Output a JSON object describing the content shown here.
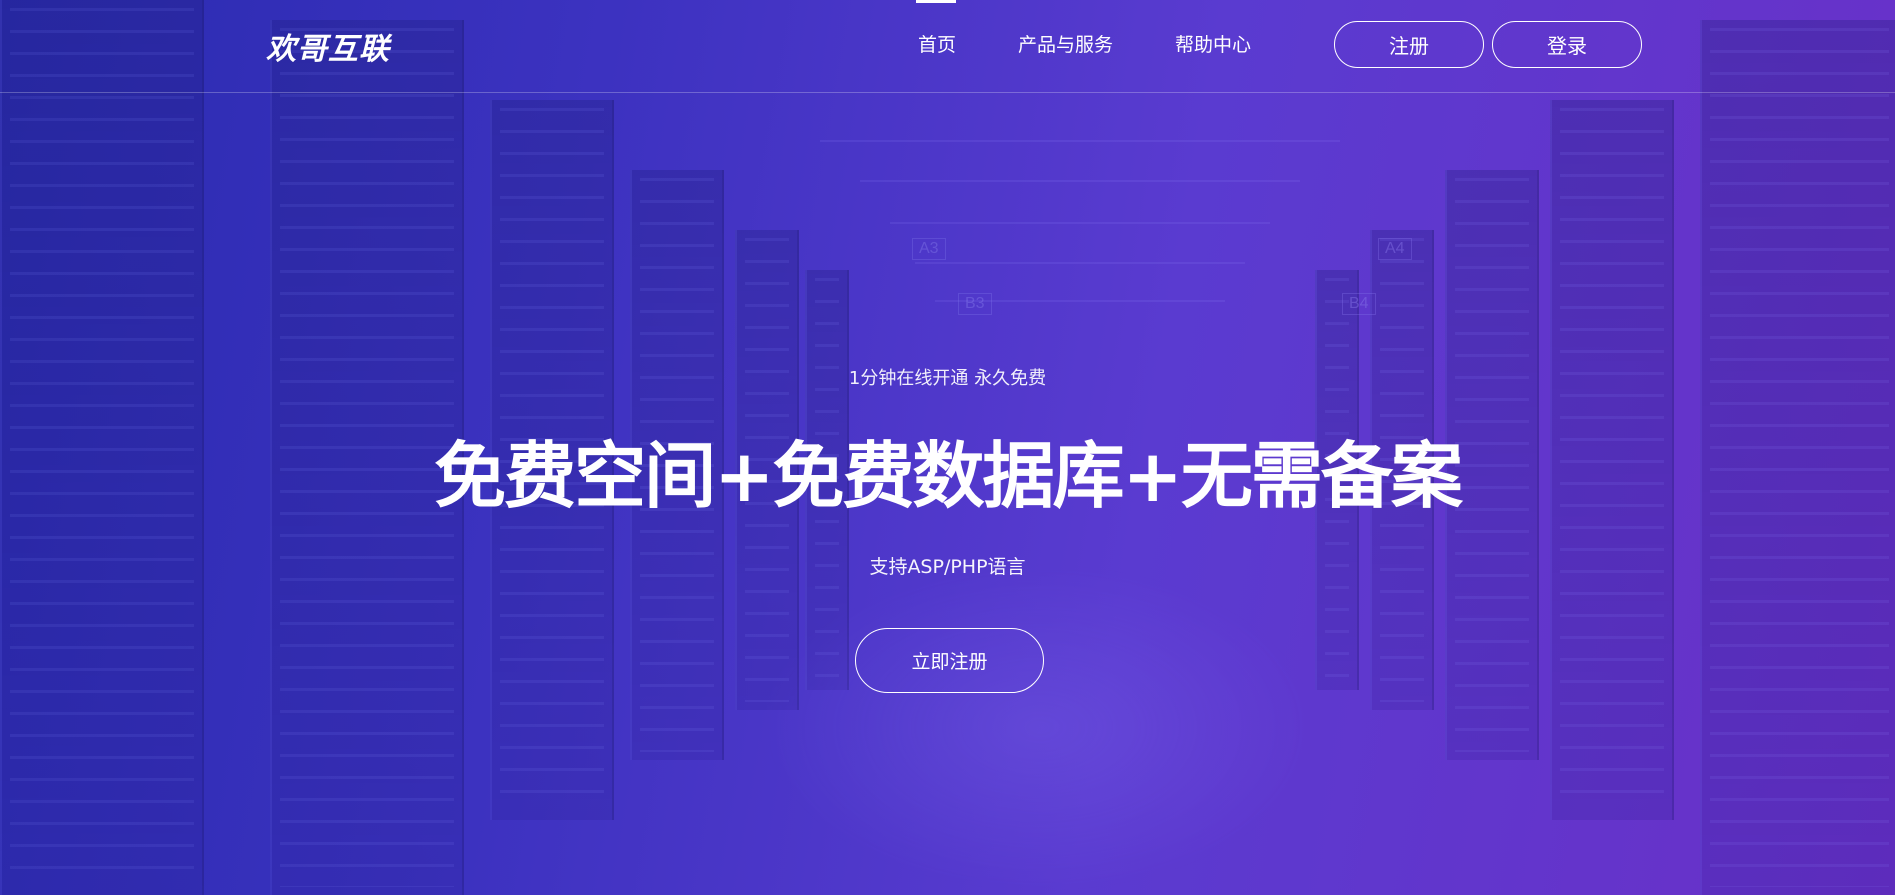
{
  "header": {
    "logo_text": "欢哥互联",
    "nav": [
      {
        "label": "首页"
      },
      {
        "label": "产品与服务"
      },
      {
        "label": "帮助中心"
      }
    ],
    "register_label": "注册",
    "login_label": "登录"
  },
  "hero": {
    "tagline": "1分钟在线开通 永久免费",
    "title": "免费空间+免费数据库+无需备案",
    "subtitle": "支持ASP/PHP语言",
    "cta_label": "立即注册"
  },
  "background": {
    "aisle_signs": [
      "A3",
      "B3",
      "A4",
      "B4"
    ]
  },
  "colors": {
    "gradient_start": "#2a2bb0",
    "gradient_end": "#6a30c8",
    "text": "#ffffff"
  }
}
